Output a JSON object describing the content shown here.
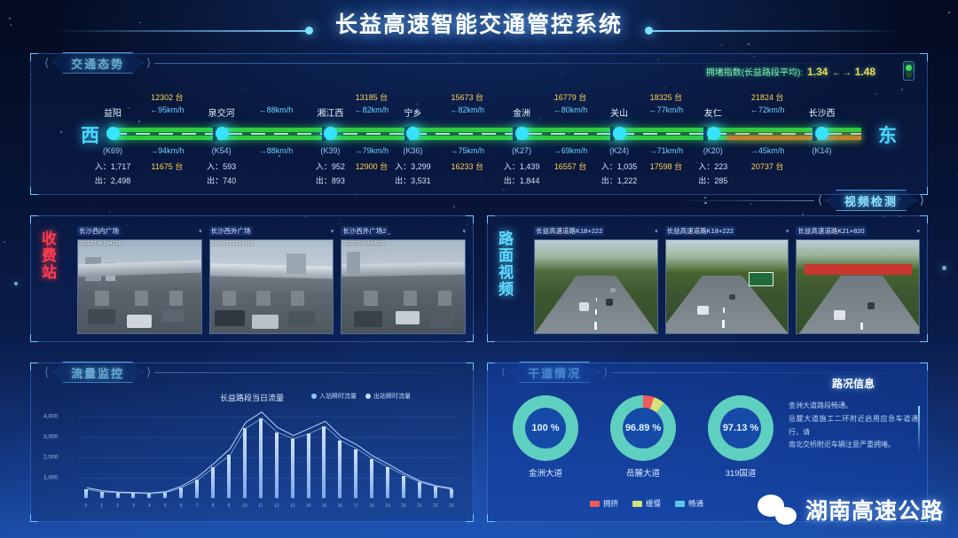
{
  "title": "长益高速智能交通管控系统",
  "sections": {
    "traffic": "交通态势",
    "video_detect": "视频检测",
    "flow": "流量监控",
    "artery": "干道情况"
  },
  "traffic": {
    "congestion_label": "拥堵指数(长益路段平均):",
    "congestion_west": "1.34",
    "congestion_east": "1.48",
    "arrow_left": "←",
    "arrow_right": "→",
    "dir_west": "西",
    "dir_east": "东",
    "stations": [
      {
        "name": "益阳",
        "km": "(K69)",
        "in_label": "入：1,717",
        "out_label": "出：2,498"
      },
      {
        "name": "泉交河",
        "km": "(K54)",
        "in_label": "入：593",
        "out_label": "出：740"
      },
      {
        "name": "湘江西",
        "km": "(K39)",
        "in_label": "入：952",
        "out_label": "出：893"
      },
      {
        "name": "宁乡",
        "km": "(K36)",
        "in_label": "入：3,299",
        "out_label": "出：3,531"
      },
      {
        "name": "金洲",
        "km": "(K27)",
        "in_label": "入：1,439",
        "out_label": "出：1,844"
      },
      {
        "name": "关山",
        "km": "(K24)",
        "in_label": "入：1,035",
        "out_label": "出：1,222"
      },
      {
        "name": "友仁",
        "km": "(K20)",
        "in_label": "入：223",
        "out_label": "出：285"
      },
      {
        "name": "长沙西",
        "km": "(K14)",
        "in_label": "",
        "out_label": ""
      }
    ],
    "segments": [
      {
        "count_west": "12302 台",
        "speed_west": "←95km/h",
        "speed_east": "→94km/h",
        "count_east": "11675 台"
      },
      {
        "count_west": "",
        "speed_west": "←88km/h",
        "speed_east": "→88km/h",
        "count_east": ""
      },
      {
        "count_west": "13185 台",
        "speed_west": "←82km/h",
        "speed_east": "→79km/h",
        "count_east": "12900 台"
      },
      {
        "count_west": "15673 台",
        "speed_west": "←82km/h",
        "speed_east": "→75km/h",
        "count_east": "16233 台"
      },
      {
        "count_west": "16779 台",
        "speed_west": "←80km/h",
        "speed_east": "→69km/h",
        "count_east": "16557 台"
      },
      {
        "count_west": "18325 台",
        "speed_west": "←77km/h",
        "speed_east": "→71km/h",
        "count_east": "17598 台"
      },
      {
        "count_west": "21824 台",
        "speed_west": "←72km/h",
        "speed_east": "→45km/h",
        "count_east": "20737 台"
      }
    ]
  },
  "toll": {
    "label": "收费站",
    "cameras": [
      {
        "name": "长沙西内广场",
        "ts": "2019-07-09 10:42:16"
      },
      {
        "name": "长沙西外广场",
        "ts": "2019-07-09 10:42:18"
      },
      {
        "name": "长沙西外广场2",
        "ts": "2019-07-09 10:42:21"
      }
    ]
  },
  "road_video": {
    "label": "路面视频",
    "cameras": [
      {
        "name": "长益高速道路K18+222"
      },
      {
        "name": "长益高速道路K18+222"
      },
      {
        "name": "长益高速道路K21+820"
      }
    ]
  },
  "chart_data": {
    "type": "bar",
    "title": "长益路段当日流量",
    "xlabel": "",
    "ylabel": "",
    "ylim": [
      0,
      4500
    ],
    "yticks": [
      "1,000",
      "2,000",
      "3,000",
      "4,000"
    ],
    "legend": [
      {
        "name": "入站瞬时流量",
        "color": "#8fc5ff"
      },
      {
        "name": "出站瞬时流量",
        "color": "#c9dcff"
      }
    ],
    "categories": [
      "0",
      "1",
      "2",
      "3",
      "4",
      "5",
      "6",
      "7",
      "8",
      "9",
      "10",
      "11",
      "12",
      "13",
      "14",
      "15",
      "16",
      "17",
      "18",
      "19",
      "20",
      "21",
      "22",
      "23"
    ],
    "series": [
      {
        "name": "入站瞬时流量",
        "values": [
          420,
          300,
          260,
          240,
          220,
          280,
          520,
          900,
          1500,
          2100,
          3400,
          3900,
          3200,
          2900,
          3150,
          3500,
          2800,
          2400,
          1900,
          1500,
          1100,
          760,
          560,
          430
        ]
      },
      {
        "name": "出站瞬时流量",
        "values": [
          500,
          360,
          300,
          270,
          250,
          320,
          600,
          1050,
          1700,
          2400,
          3700,
          4200,
          3450,
          3050,
          3400,
          3750,
          3000,
          2600,
          2050,
          1650,
          1200,
          820,
          600,
          470
        ]
      }
    ]
  },
  "artery": {
    "gauges": [
      {
        "pct": "100 %",
        "name": "金洲大道",
        "smooth": 100,
        "slow": 0,
        "jam": 0
      },
      {
        "pct": "96.89 %",
        "name": "岳麓大道",
        "smooth": 89.0,
        "slow": 5.5,
        "jam": 5.5
      },
      {
        "pct": "97.13 %",
        "name": "319国道",
        "smooth": 100,
        "slow": 0,
        "jam": 0
      }
    ],
    "legend": [
      {
        "name": "拥挤",
        "color": "#ef5a5a"
      },
      {
        "name": "缓慢",
        "color": "#d7e07a"
      },
      {
        "name": "畅通",
        "color": "#59c8e8"
      }
    ],
    "info_title": "路况信息",
    "info_lines": [
      "金洲大道路段畅通。",
      "岳麓大道施工二环附近启用应急车道通行，请",
      "南北交桥附近车辆注意严重拥堵。"
    ]
  },
  "watermark": "湖南高速公路",
  "colors": {
    "accent": "#37e4ff",
    "green_road": "#2ecc3f",
    "amber_road": "#c0822a",
    "highlight": "#ffd257"
  }
}
